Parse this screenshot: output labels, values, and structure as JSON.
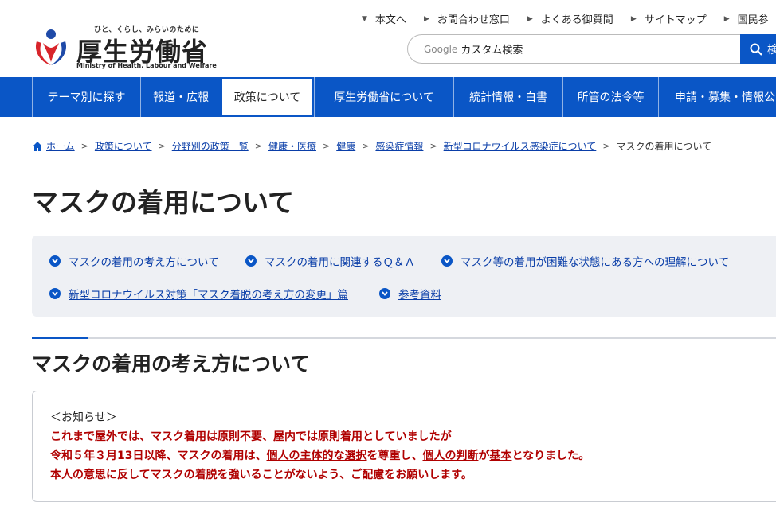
{
  "header": {
    "tagline": "ひと、くらし、みらいのために",
    "title": "厚生労働省",
    "title_en": "Ministry of Health, Labour and Welfare",
    "util_links": [
      "本文へ",
      "お問合わせ窓口",
      "よくある御質問",
      "サイトマップ",
      "国民参"
    ],
    "search_brand": "Google",
    "search_placeholder": "カスタム検索",
    "search_button": "検"
  },
  "gnav": [
    "テーマ別に探す",
    "報道・広報",
    "政策について",
    "厚生労働省について",
    "統計情報・白書",
    "所管の法令等",
    "申請・募集・情報公"
  ],
  "breadcrumb": {
    "links": [
      "ホーム",
      "政策について",
      "分野別の政策一覧",
      "健康・医療",
      "健康",
      "感染症情報",
      "新型コロナウイルス感染症について"
    ],
    "current": "マスクの着用について"
  },
  "page_title": "マスクの着用について",
  "anchors": [
    "マスクの着用の考え方について",
    "マスクの着用に関連するＱ＆Ａ",
    "マスク等の着用が困難な状態にある方への理解について",
    "新型コロナウイルス対策「マスク着脱の考え方の変更」篇",
    "参考資料"
  ],
  "section_title": "マスクの着用の考え方について",
  "notice": {
    "head": "＜お知らせ＞",
    "line1": "これまで屋外では、マスク着用は原則不要、屋内では原則着用としていましたが",
    "line2_a": "令和５年３月13日以降、マスクの着用は、",
    "line2_b": "個人の主体的な選択",
    "line2_c": "を尊重し、",
    "line2_d": "個人の判断",
    "line2_e": "が",
    "line2_f": "基本",
    "line2_g": "となりました。",
    "line3": "本人の意思に反してマスクの着脱を強いることがないよう、ご配慮をお願いします。"
  },
  "colors": {
    "brand_blue": "#0a56c6",
    "link": "#0a3ea8",
    "alert_red": "#b00000",
    "panel_bg": "#eef0f4"
  }
}
